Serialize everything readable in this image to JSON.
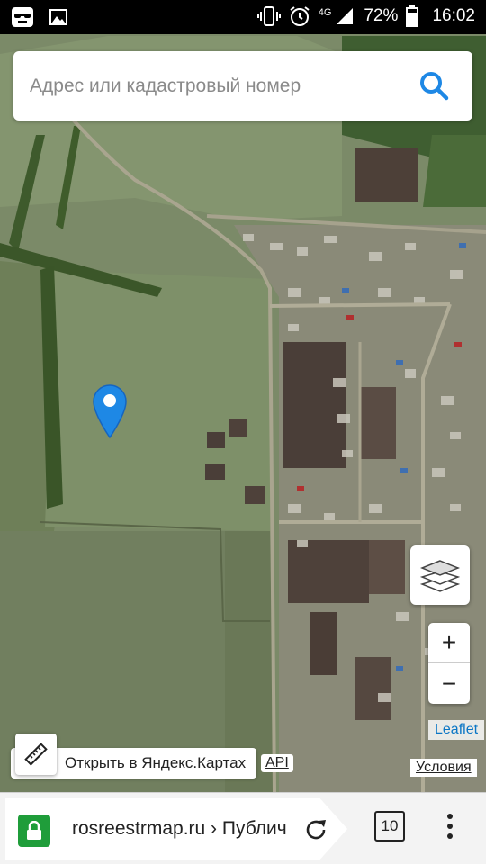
{
  "statusbar": {
    "battery_percent": "72%",
    "time": "16:02",
    "network": "4G",
    "icons": [
      "incognito-icon",
      "image-icon",
      "vibrate-icon",
      "alarm-icon",
      "signal-icon",
      "battery-icon"
    ]
  },
  "search": {
    "placeholder": "Адрес или кадастровый номер",
    "value": "",
    "icon": "search-icon",
    "accent_color": "#1e88e5"
  },
  "map": {
    "layers_icon": "layers-icon",
    "zoom_in_label": "+",
    "zoom_out_label": "−",
    "attribution_link": "Leaflet",
    "yandex_link": "Открыть в Яндекс.Картах",
    "api_link": "API",
    "terms_link": "Условия",
    "marker_icon": "map-pin-icon",
    "marker_color": "#1e88e5"
  },
  "browser": {
    "url": "rosreestrmap.ru › Публичная кадастровая карта",
    "tab_count": "10",
    "secure_color": "#1f9d3a"
  }
}
